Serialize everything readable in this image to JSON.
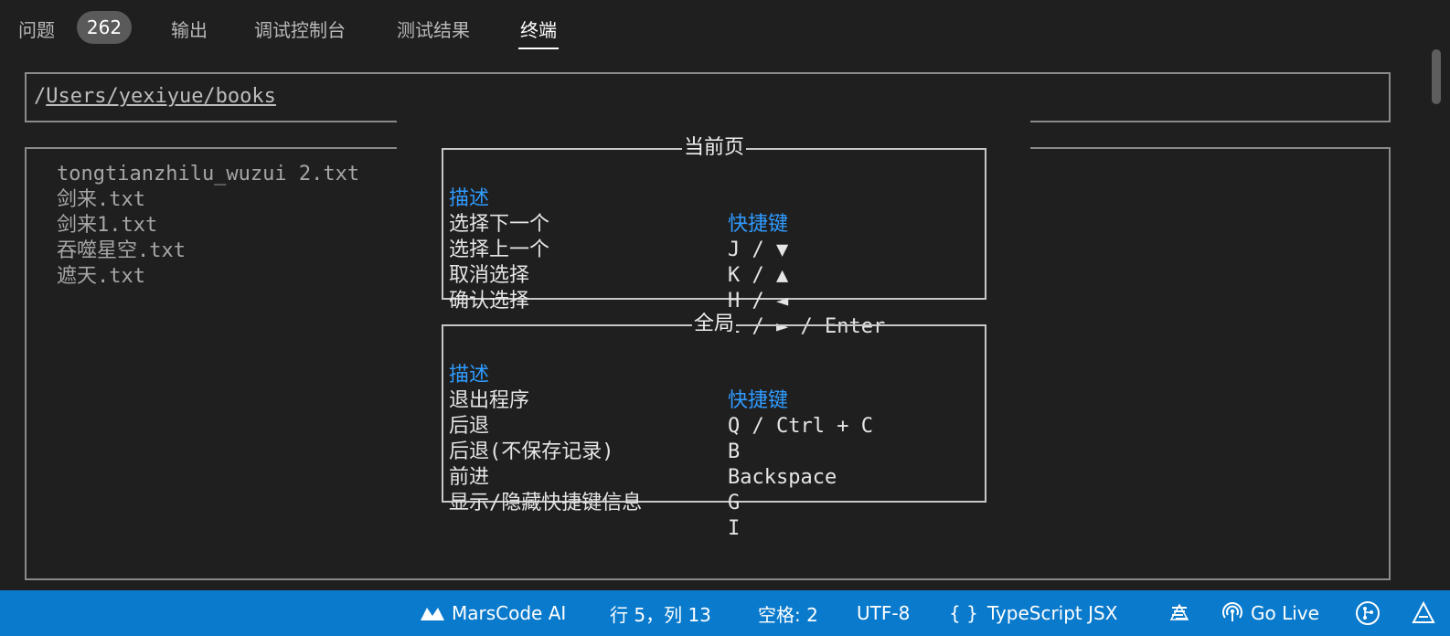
{
  "tabs": {
    "problems": "问题",
    "problems_count": "262",
    "output": "输出",
    "debug_console": "调试控制台",
    "test_results": "测试结果",
    "terminal": "终端"
  },
  "terminal": {
    "path": "/Users/yexiyue/books",
    "path_prefix": "/",
    "path_rest": "Users/yexiyue/books",
    "files": [
      "tongtianzhilu_wuzui 2.txt",
      "剑来.txt",
      "剑来1.txt",
      "吞噬星空.txt",
      "遮天.txt"
    ]
  },
  "help": {
    "current_page": {
      "title": "当前页",
      "header_desc": "描述",
      "header_key": "快捷键",
      "rows": [
        {
          "desc": "选择下一个",
          "key": "J / ▼"
        },
        {
          "desc": "选择上一个",
          "key": "K / ▲"
        },
        {
          "desc": "取消选择",
          "key": "H / ◄"
        },
        {
          "desc": "确认选择",
          "key": "L / ► / Enter"
        }
      ]
    },
    "global": {
      "title": "全局",
      "header_desc": "描述",
      "header_key": "快捷键",
      "rows": [
        {
          "desc": "退出程序",
          "key": "Q / Ctrl + C"
        },
        {
          "desc": "后退",
          "key": "B"
        },
        {
          "desc": "后退(不保存记录)",
          "key": "Backspace"
        },
        {
          "desc": "前进",
          "key": "G"
        },
        {
          "desc": "显示/隐藏快捷键信息",
          "key": "I"
        }
      ]
    }
  },
  "statusbar": {
    "marscode": "MarsCode AI",
    "position": "行 5，列 13",
    "indent": "空格: 2",
    "encoding": "UTF-8",
    "language": "TypeScript JSX",
    "golive": "Go Live",
    "icons": [
      "marscode-icon",
      "braces-icon",
      "prettier-icon",
      "broadcast-icon",
      "git-icon",
      "notification-icon"
    ]
  },
  "colors": {
    "background": "#1f1f1f",
    "statusbar": "#0a7acc",
    "help_header": "#2f9bff",
    "border": "#8a8a8a"
  }
}
